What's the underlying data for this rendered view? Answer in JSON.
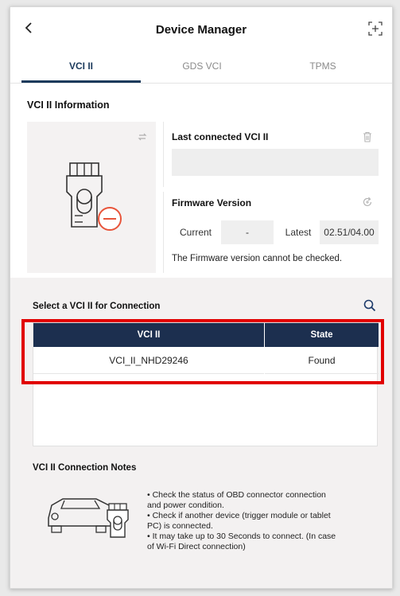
{
  "header": {
    "title": "Device Manager",
    "back_icon": "chevron-left-icon",
    "expand_icon": "expand-icon"
  },
  "tabs": [
    {
      "label": "VCI II",
      "active": true
    },
    {
      "label": "GDS VCI",
      "active": false
    },
    {
      "label": "TPMS",
      "active": false
    }
  ],
  "info": {
    "title": "VCI II Information",
    "last_connected_label": "Last connected VCI II",
    "last_connected_value": "",
    "firmware_label": "Firmware Version",
    "current_label": "Current",
    "current_value": "-",
    "latest_label": "Latest",
    "latest_value": "02.51/04.00",
    "firmware_message": "The Firmware version cannot be checked."
  },
  "select": {
    "title": "Select a VCI II for Connection",
    "columns": [
      "VCI II",
      "State"
    ],
    "rows": [
      {
        "name": "VCI_II_NHD29246",
        "state": "Found"
      }
    ]
  },
  "notes": {
    "title": "VCI II Connection Notes",
    "lines": [
      "• Check the status of OBD connector connection",
      "and power condition.",
      "• Check if another device (trigger module or tablet",
      "PC) is connected.",
      "• It may take up to 30 Seconds to connect. (In case",
      "of Wi-Fi Direct connection)"
    ]
  },
  "colors": {
    "accent": "#1b3a5c",
    "table_header": "#1c2f4f",
    "highlight": "#e10000",
    "error_icon": "#e8543a"
  }
}
